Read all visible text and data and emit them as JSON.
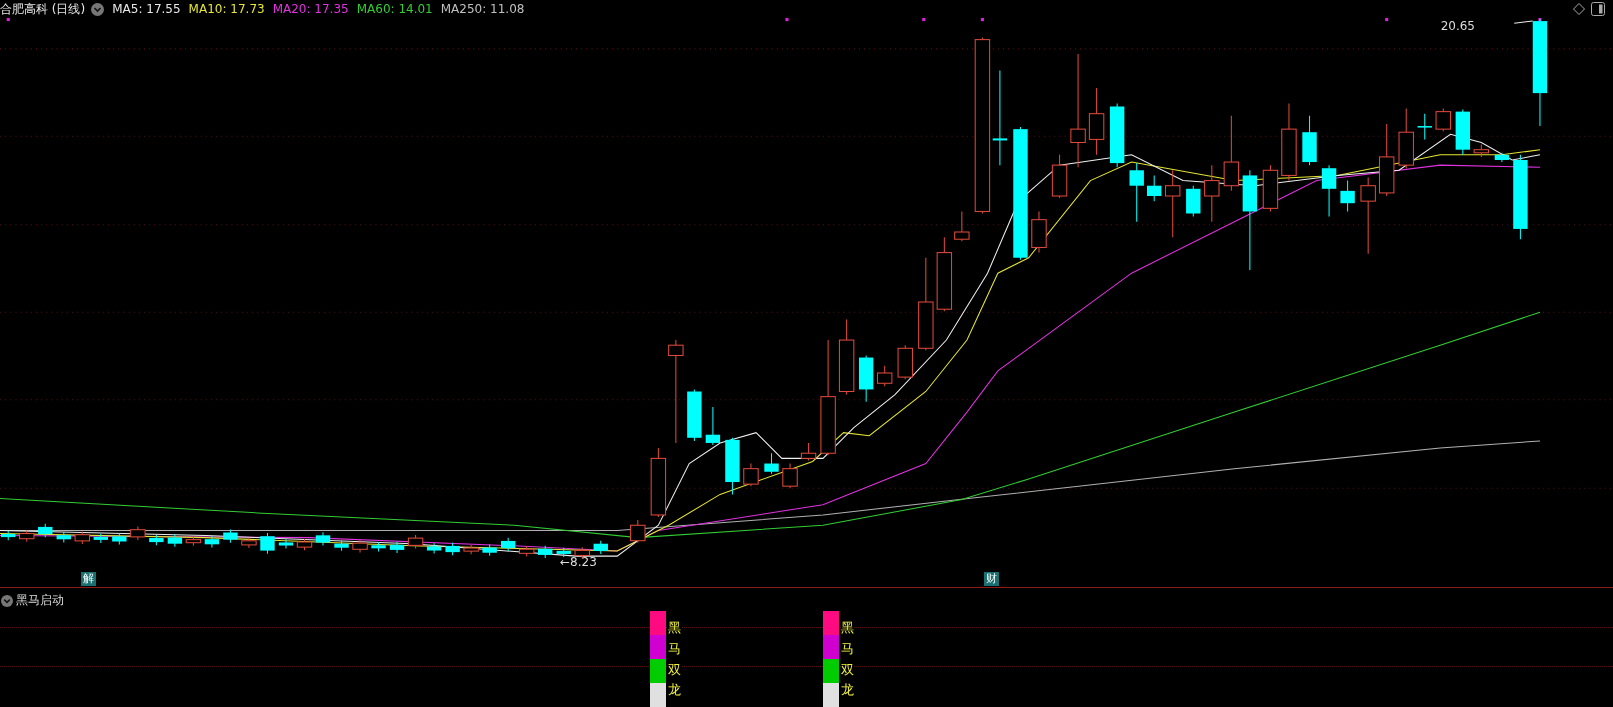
{
  "header": {
    "title": "合肥高科",
    "period": "(日线)",
    "moving_averages": [
      {
        "name": "MA5:",
        "value": "17.55",
        "color": "#e8e8e8"
      },
      {
        "name": "MA10:",
        "value": "17.73",
        "color": "#e6e632"
      },
      {
        "name": "MA20:",
        "value": "17.35",
        "color": "#e032e0"
      },
      {
        "name": "MA60:",
        "value": "14.01",
        "color": "#32cd32"
      },
      {
        "name": "MA250:",
        "value": "11.08",
        "color": "#c0c0c0"
      }
    ]
  },
  "chart": {
    "high_label": "20.65",
    "low_label": "←8.23",
    "events": [
      {
        "label": "解"
      },
      {
        "label": "财"
      }
    ]
  },
  "indicator": {
    "title": "黑马启动",
    "signals": [
      {
        "text": "黑马双龙"
      },
      {
        "text": "黑马双龙"
      }
    ]
  }
}
